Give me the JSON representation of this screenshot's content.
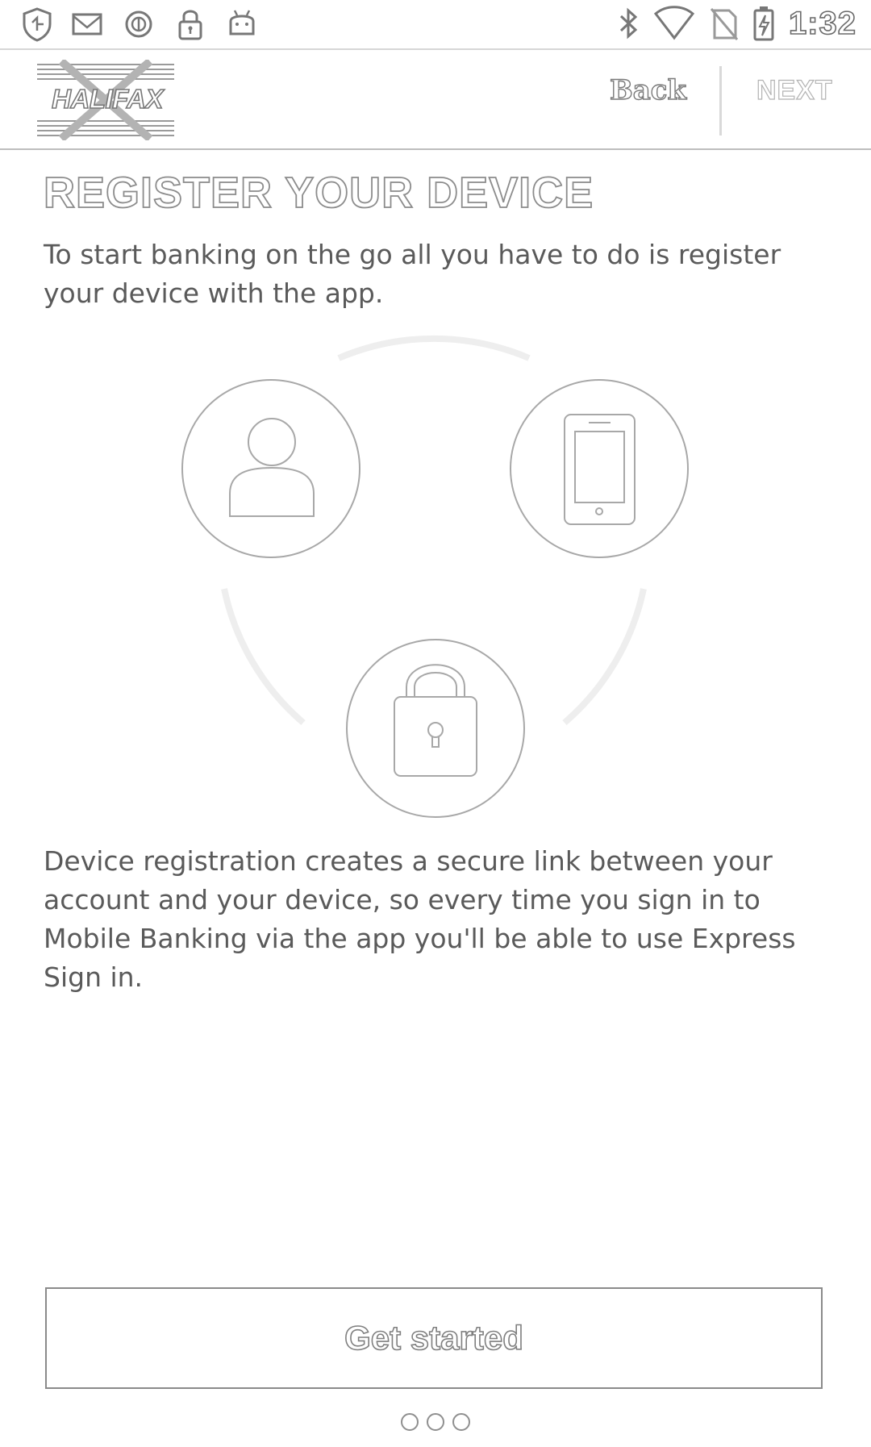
{
  "status_bar": {
    "time": "1:32",
    "left_icons": [
      "shield-icon",
      "mail-icon",
      "circle-icon",
      "lock-icon",
      "android-icon"
    ],
    "right_icons": [
      "bluetooth-icon",
      "wifi-icon",
      "no-sim-icon",
      "battery-charging-icon"
    ]
  },
  "header": {
    "logo_text": "HALIFAX",
    "back_label": "Back",
    "next_label": "NEXT"
  },
  "main": {
    "title": "REGISTER YOUR DEVICE",
    "intro": "To start banking on the go all you have to do is register your device with the app.",
    "illustration_icons": [
      "user-icon",
      "smartphone-icon",
      "padlock-icon"
    ],
    "description": "Device registration creates a secure link between your account and your device, so every time you sign in to Mobile Banking via the app you'll be able to use Express Sign in.",
    "cta_label": "Get started"
  },
  "pager": {
    "count": 3,
    "active": 0
  },
  "colors": {
    "outline": "#8c8c8c",
    "text": "#5a5a5a",
    "background": "#ffffff"
  }
}
